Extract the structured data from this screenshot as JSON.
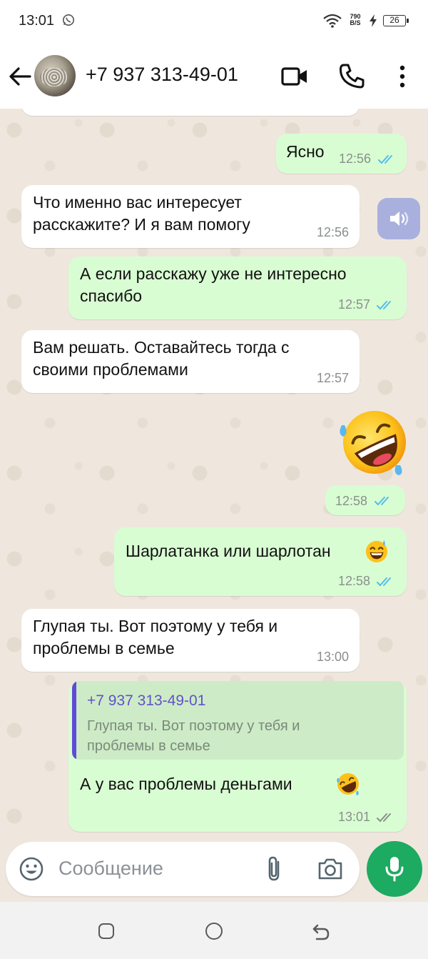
{
  "status_bar": {
    "time": "13:01",
    "net_speed_value": "790",
    "net_speed_unit": "B/S",
    "battery": "26",
    "icons": [
      "whatsapp-notification-icon",
      "wifi-icon",
      "charging-bolt-icon",
      "battery-icon"
    ]
  },
  "header": {
    "contact_name": "+7 937 313-49-01",
    "icons": [
      "back-arrow-icon",
      "video-call-icon",
      "voice-call-icon",
      "more-vert-icon"
    ]
  },
  "messages": [
    {
      "dir": "out",
      "text": [
        "Ясно"
      ],
      "time": "12:56",
      "status": "read"
    },
    {
      "dir": "in",
      "text": [
        "Что именно вас интересует",
        "расскажите? И я вам помогу"
      ],
      "time": "12:56"
    },
    {
      "dir": "out",
      "text": [
        "А если расскажу уже не интересно",
        "спасибо"
      ],
      "time": "12:57",
      "status": "read"
    },
    {
      "dir": "in",
      "text": [
        "Вам решать. Оставайтесь тогда с",
        "своими проблемами"
      ],
      "time": "12:57"
    },
    {
      "dir": "out",
      "emoji": "rolling-on-floor-laughing",
      "time": "12:58",
      "status": "read"
    },
    {
      "dir": "out",
      "text": [
        "Шарлатанка или шарлотан"
      ],
      "time": "12:58",
      "status": "read"
    },
    {
      "dir": "in",
      "text": [
        "Глупая ты. Вот поэтому у тебя и",
        "проблемы в семье"
      ],
      "time": "13:00"
    },
    {
      "dir": "out",
      "quote": {
        "author": "+7 937 313-49-01",
        "text": [
          "Глупая ты. Вот поэтому у тебя и",
          "проблемы в семье"
        ]
      },
      "text": [
        "А у вас проблемы деньгами"
      ],
      "time": "13:01",
      "status": "delivered"
    }
  ],
  "input": {
    "placeholder": "Сообщение"
  },
  "colors": {
    "outgoing_bubble": "#d9fdd3",
    "incoming_bubble": "#ffffff",
    "read_ticks": "#53bdeb",
    "mic_button": "#1daa61",
    "quote_accent": "#5f4bd6",
    "chat_background": "#efe7de"
  }
}
